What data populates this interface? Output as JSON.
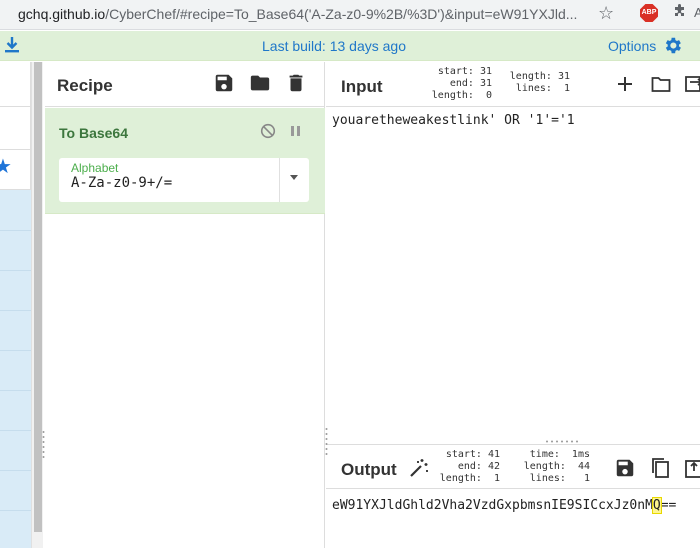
{
  "browser": {
    "url_host": "gchq.github.io",
    "url_path": "/CyberChef/#recipe=To_Base64('A-Za-z0-9%2B/%3D')&input=eW91YXJld...",
    "abp_label": "ABP"
  },
  "banner": {
    "last_build": "Last build: 13 days ago",
    "options_label": "Options"
  },
  "recipe": {
    "title": "Recipe",
    "operation": {
      "name": "To Base64",
      "alphabet_label": "Alphabet",
      "alphabet_value": "A-Za-z0-9+/="
    }
  },
  "input": {
    "title": "Input",
    "stats_left": "start: 31\nend: 31\nlength:  0",
    "stats_right": "length: 31\nlines:  1",
    "text": "youaretheweakestlink' OR '1'='1"
  },
  "output": {
    "title": "Output",
    "stats_left": "start: 41\nend: 42\nlength:  1",
    "stats_right": "time:  1ms\nlength:  44\nlines:   1",
    "text_before": "eW91YXJldGhld2Vha2VzdGxpbmsnIE9SICcxJz0nM",
    "text_highlight": "Q",
    "text_after": "=="
  },
  "colors": {
    "banner_bg": "#dff0d8",
    "op_bg": "#dff0d8",
    "op_title": "#3c763d",
    "link_blue": "#1f77c9",
    "highlight": "#fff68f"
  }
}
